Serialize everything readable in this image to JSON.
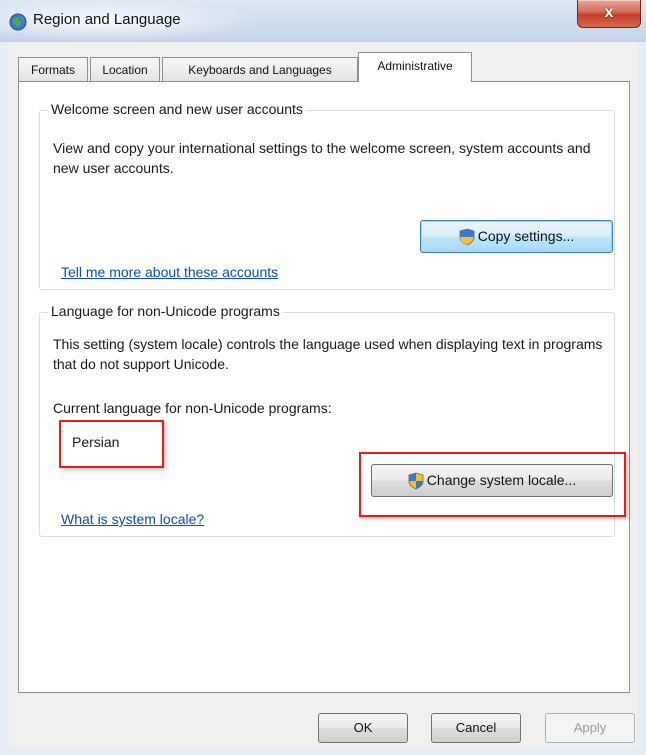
{
  "window": {
    "title": "Region and Language",
    "close_symbol": "x"
  },
  "tabs": [
    {
      "label": "Formats",
      "selected": false
    },
    {
      "label": "Location",
      "selected": false
    },
    {
      "label": "Keyboards and Languages",
      "selected": false
    },
    {
      "label": "Administrative",
      "selected": true
    }
  ],
  "welcome_group": {
    "title": "Welcome screen and new user accounts",
    "description": "View and copy your international settings to the welcome screen, system accounts and new user accounts.",
    "copy_button_label": "Copy settings...",
    "link_text": "Tell me more about these accounts"
  },
  "unicode_group": {
    "title": "Language for non-Unicode programs",
    "description": "This setting (system locale) controls the language used when displaying text in programs that do not support Unicode.",
    "current_label": "Current language for non-Unicode programs:",
    "current_value": "Persian",
    "change_button_label": "Change system locale...",
    "link_text": "What is system locale?"
  },
  "dialog_buttons": {
    "ok": "OK",
    "cancel": "Cancel",
    "apply": "Apply"
  },
  "colors": {
    "highlight_box": "#e02020",
    "link": "#0b4fb8",
    "close_button": "#c43e28"
  },
  "icons": {
    "app": "globe-icon",
    "button": "uac-shield-icon"
  }
}
